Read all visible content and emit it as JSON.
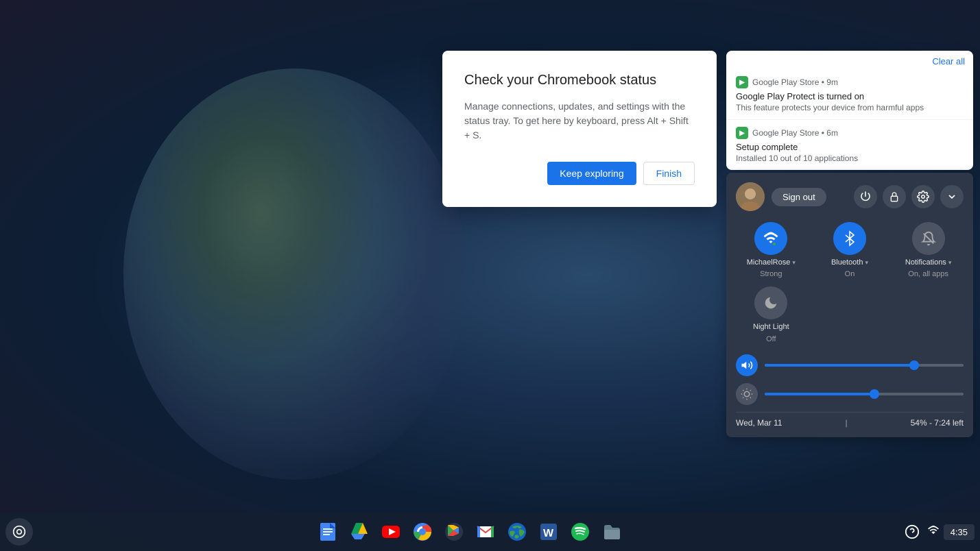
{
  "desktop": {
    "background": "dark blue gradient"
  },
  "dialog": {
    "title": "Check your Chromebook status",
    "body": "Manage connections, updates, and settings with the status tray. To get here by keyboard, press Alt + Shift + S.",
    "btn_keep_exploring": "Keep exploring",
    "btn_finish": "Finish"
  },
  "notifications": {
    "clear_all": "Clear all",
    "items": [
      {
        "source": "Google Play Store",
        "time": "9m",
        "title": "Google Play Protect is turned on",
        "body": "This feature protects your device from harmful apps"
      },
      {
        "source": "Google Play Store",
        "time": "6m",
        "title": "Setup complete",
        "body": "Installed 10 out of 10 applications"
      }
    ]
  },
  "quick_settings": {
    "sign_out": "Sign out",
    "tiles": [
      {
        "id": "wifi",
        "label": "MichaelRose",
        "sublabel": "Strong",
        "active": true,
        "has_dropdown": true
      },
      {
        "id": "bluetooth",
        "label": "Bluetooth",
        "sublabel": "On",
        "active": true,
        "has_dropdown": true
      },
      {
        "id": "notifications",
        "label": "Notifications",
        "sublabel": "On, all apps",
        "active": false,
        "has_dropdown": true
      },
      {
        "id": "night_light",
        "label": "Night Light",
        "sublabel": "Off",
        "active": false,
        "has_dropdown": false
      }
    ],
    "volume_percent": 75,
    "brightness_percent": 55,
    "date": "Wed, Mar 11",
    "battery": "54% - 7:24 left"
  },
  "taskbar": {
    "time": "4:35",
    "apps": [
      {
        "name": "Google Docs",
        "icon": "📄"
      },
      {
        "name": "Google Drive",
        "icon": "△"
      },
      {
        "name": "YouTube",
        "icon": "▶"
      },
      {
        "name": "Chrome",
        "icon": "⊙"
      },
      {
        "name": "Google Play",
        "icon": "▷"
      },
      {
        "name": "Gmail",
        "icon": "M"
      },
      {
        "name": "Earth",
        "icon": "🌐"
      },
      {
        "name": "Word",
        "icon": "W"
      },
      {
        "name": "Spotify",
        "icon": "♫"
      },
      {
        "name": "Files",
        "icon": "📁"
      }
    ]
  }
}
